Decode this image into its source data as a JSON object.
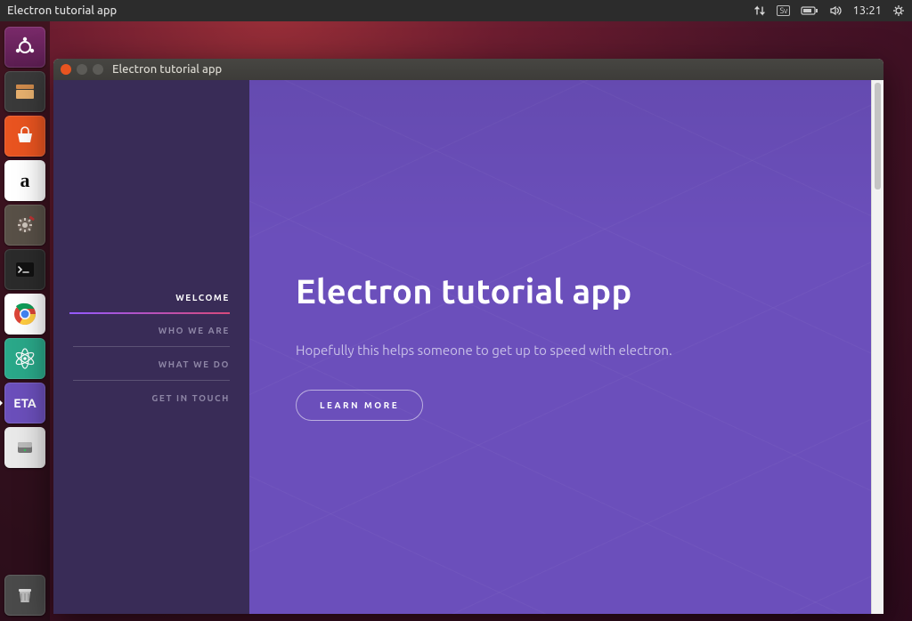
{
  "topbar": {
    "app_title": "Electron tutorial app",
    "keyboard_indicator": "Sv",
    "time": "13:21"
  },
  "launcher": {
    "items": [
      {
        "name": "dash-icon"
      },
      {
        "name": "files-icon"
      },
      {
        "name": "software-store-icon"
      },
      {
        "name": "amazon-icon",
        "label": "a"
      },
      {
        "name": "settings-icon"
      },
      {
        "name": "terminal-icon"
      },
      {
        "name": "chrome-icon"
      },
      {
        "name": "atom-icon"
      },
      {
        "name": "eta-app-icon",
        "label": "ETA"
      },
      {
        "name": "disks-icon"
      }
    ],
    "trash": {
      "name": "trash-icon"
    }
  },
  "window": {
    "title": "Electron tutorial app"
  },
  "sidebar": {
    "items": [
      {
        "label": "WELCOME",
        "active": true
      },
      {
        "label": "WHO WE ARE",
        "active": false
      },
      {
        "label": "WHAT WE DO",
        "active": false
      },
      {
        "label": "GET IN TOUCH",
        "active": false
      }
    ]
  },
  "content": {
    "heading": "Electron tutorial app",
    "subtext": "Hopefully this helps someone to get up to speed with electron.",
    "cta_label": "LEARN MORE"
  }
}
